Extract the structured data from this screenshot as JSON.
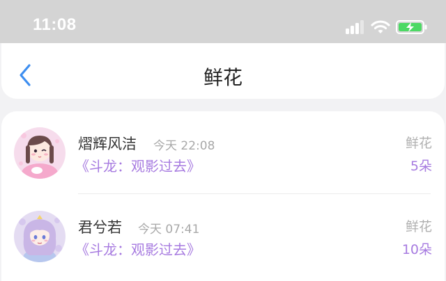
{
  "status_bar": {
    "time": "11:08",
    "icons": [
      "signal-icon",
      "wifi-icon",
      "battery-charging-icon"
    ]
  },
  "nav": {
    "title": "鲜花",
    "back_icon": "chevron-left-icon"
  },
  "records": [
    {
      "username": "熠辉风洁",
      "time": "今天 22:08",
      "book": "《斗龙：观影过去》",
      "gift_type": "鲜花",
      "gift_count": "5朵"
    },
    {
      "username": "君兮若",
      "time": "今天 07:41",
      "book": "《斗龙：观影过去》",
      "gift_type": "鲜花",
      "gift_count": "10朵"
    }
  ],
  "colors": {
    "accent_purple": "#a77be0",
    "back_blue": "#3d8ef0",
    "status_bar_bg": "#d4d4d4",
    "battery_green": "#4cd964"
  }
}
